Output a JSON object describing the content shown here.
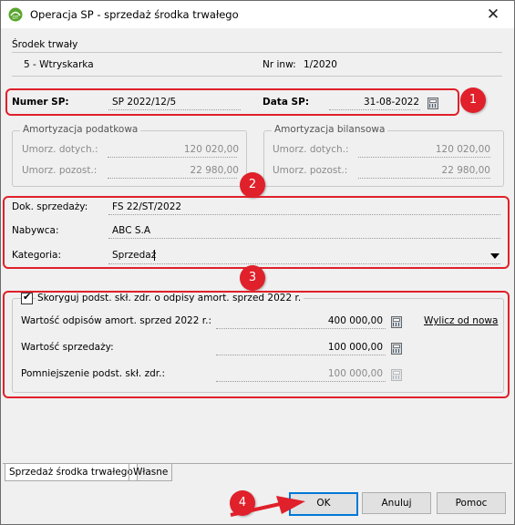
{
  "window": {
    "title": "Operacja SP - sprzedaż środka trwałego",
    "close_glyph": "✕"
  },
  "asset": {
    "section_label": "Środek trwały",
    "name": "5 - Wtryskarka",
    "inv_label": "Nr inw:",
    "inv_value": "1/2020"
  },
  "sp": {
    "number_label": "Numer SP:",
    "number_value": "SP 2022/12/5",
    "date_label": "Data SP:",
    "date_value": "31-08-2022"
  },
  "tax_amort": {
    "title": "Amortyzacja podatkowa",
    "dotych_label": "Umorz. dotych.:",
    "dotych_value": "120 020,00",
    "pozost_label": "Umorz. pozost.:",
    "pozost_value": "22 980,00"
  },
  "balance_amort": {
    "title": "Amortyzacja bilansowa",
    "dotych_label": "Umorz. dotych.:",
    "dotych_value": "120 020,00",
    "pozost_label": "Umorz. pozost.:",
    "pozost_value": "22 980,00"
  },
  "sale": {
    "doc_label": "Dok. sprzedaży:",
    "doc_value": "FS 22/ST/2022",
    "buyer_label": "Nabywca:",
    "buyer_value": "ABC S.A",
    "category_label": "Kategoria:",
    "category_value": "Sprzedaż"
  },
  "health": {
    "checkbox_label": "Skoryguj podst. skł. zdr. o odpisy amort. sprzed 2022 r.",
    "checked": true,
    "check_glyph": "✔",
    "odpisy_label": "Wartość odpisów amort. sprzed 2022 r.:",
    "odpisy_value": "400 000,00",
    "recalc_link": "Wylicz od nowa",
    "sprzedazy_label": "Wartość sprzedaży:",
    "sprzedazy_value": "100 000,00",
    "pomniejszenie_label": "Pomniejszenie podst. skł. zdr.:",
    "pomniejszenie_value": "100 000,00"
  },
  "tabs": [
    {
      "label": "Sprzedaż środka trwałego",
      "active": true
    },
    {
      "label": "Własne",
      "active": false
    }
  ],
  "buttons": {
    "ok": "OK",
    "cancel": "Anuluj",
    "help": "Pomoc"
  },
  "annotations": {
    "badge1": "1",
    "badge2": "2",
    "badge3": "3",
    "badge4": "4",
    "color": "#e0202a"
  }
}
